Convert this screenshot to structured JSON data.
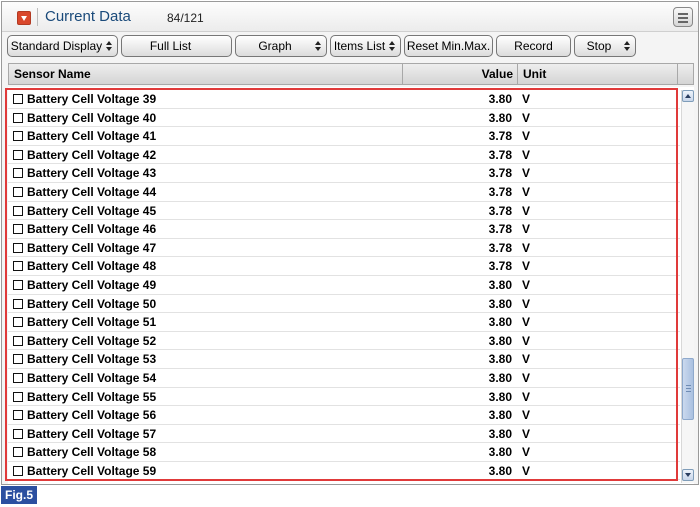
{
  "window": {
    "title": "Current Data",
    "count": "84/121"
  },
  "toolbar": {
    "standard_display": "Standard Display",
    "full_list": "Full List",
    "graph": "Graph",
    "items_list": "Items List",
    "reset_min_max": "Reset Min.Max.",
    "record": "Record",
    "stop": "Stop"
  },
  "table": {
    "headers": {
      "sensor_name": "Sensor Name",
      "value": "Value",
      "unit": "Unit"
    },
    "rows": [
      {
        "name": "Battery Cell Voltage 39",
        "value": "3.80",
        "unit": "V"
      },
      {
        "name": "Battery Cell Voltage 40",
        "value": "3.80",
        "unit": "V"
      },
      {
        "name": "Battery Cell Voltage 41",
        "value": "3.78",
        "unit": "V"
      },
      {
        "name": "Battery Cell Voltage 42",
        "value": "3.78",
        "unit": "V"
      },
      {
        "name": "Battery Cell Voltage 43",
        "value": "3.78",
        "unit": "V"
      },
      {
        "name": "Battery Cell Voltage 44",
        "value": "3.78",
        "unit": "V"
      },
      {
        "name": "Battery Cell Voltage 45",
        "value": "3.78",
        "unit": "V"
      },
      {
        "name": "Battery Cell Voltage 46",
        "value": "3.78",
        "unit": "V"
      },
      {
        "name": "Battery Cell Voltage 47",
        "value": "3.78",
        "unit": "V"
      },
      {
        "name": "Battery Cell Voltage 48",
        "value": "3.78",
        "unit": "V"
      },
      {
        "name": "Battery Cell Voltage 49",
        "value": "3.80",
        "unit": "V"
      },
      {
        "name": "Battery Cell Voltage 50",
        "value": "3.80",
        "unit": "V"
      },
      {
        "name": "Battery Cell Voltage 51",
        "value": "3.80",
        "unit": "V"
      },
      {
        "name": "Battery Cell Voltage 52",
        "value": "3.80",
        "unit": "V"
      },
      {
        "name": "Battery Cell Voltage 53",
        "value": "3.80",
        "unit": "V"
      },
      {
        "name": "Battery Cell Voltage 54",
        "value": "3.80",
        "unit": "V"
      },
      {
        "name": "Battery Cell Voltage 55",
        "value": "3.80",
        "unit": "V"
      },
      {
        "name": "Battery Cell Voltage 56",
        "value": "3.80",
        "unit": "V"
      },
      {
        "name": "Battery Cell Voltage 57",
        "value": "3.80",
        "unit": "V"
      },
      {
        "name": "Battery Cell Voltage 58",
        "value": "3.80",
        "unit": "V"
      },
      {
        "name": "Battery Cell Voltage 59",
        "value": "3.80",
        "unit": "V"
      }
    ]
  },
  "figure_label": "Fig.5",
  "colors": {
    "title_text": "#1a4a7a",
    "collapse_button": "#d9472b",
    "highlight_border": "#e03a3a",
    "figure_label_bg": "#2b4fa0"
  },
  "icons": {
    "collapse": "collapse-arrow-icon",
    "menu": "menu-icon",
    "scroll_up": "scroll-up-arrow-icon",
    "scroll_down": "scroll-down-arrow-icon"
  }
}
